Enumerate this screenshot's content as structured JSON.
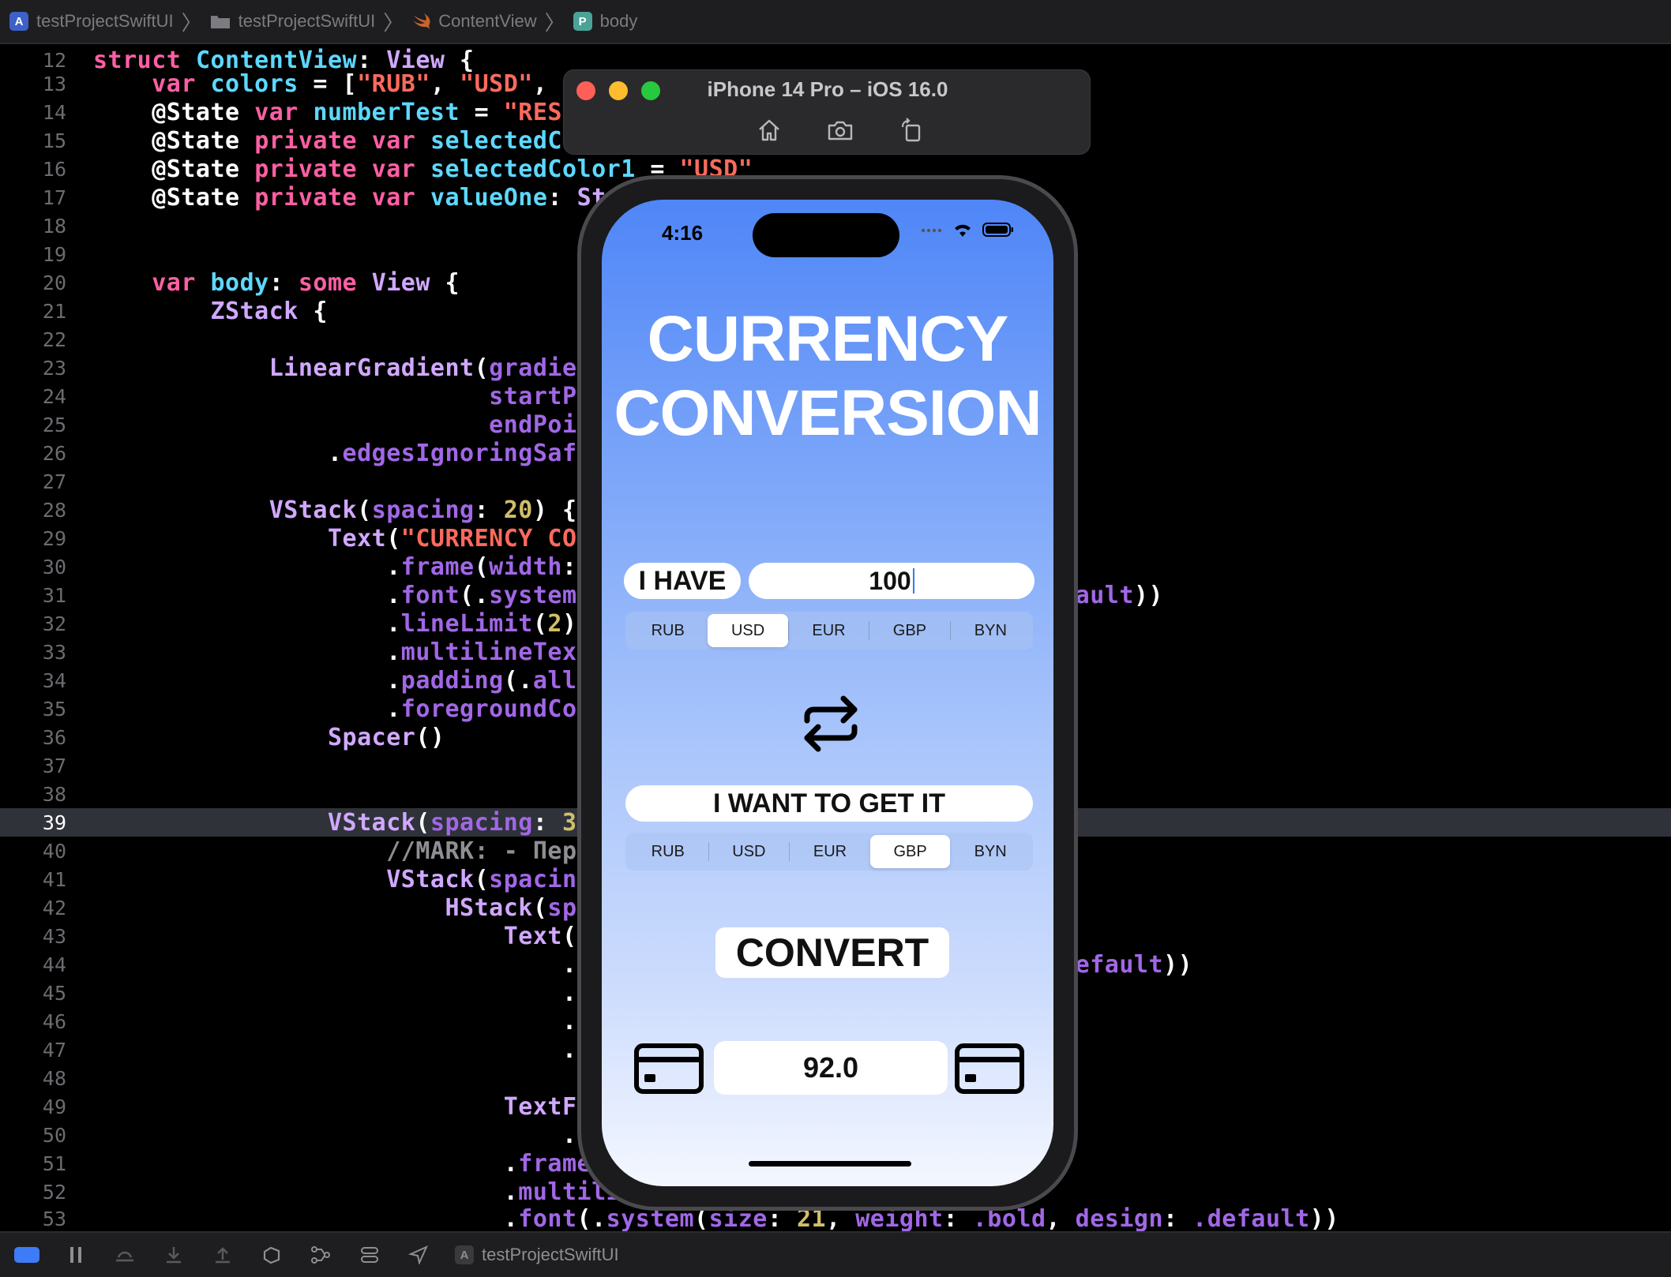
{
  "breadcrumb": {
    "items": [
      "testProjectSwiftUI",
      "testProjectSwiftUI",
      "ContentView",
      "body"
    ],
    "icons": [
      "xcode-project-icon",
      "folder-icon",
      "swift-icon",
      "property-icon"
    ]
  },
  "editor": {
    "current_line": "39",
    "lines": [
      {
        "n": "12"
      },
      {
        "n": "13"
      },
      {
        "n": "14"
      },
      {
        "n": "15"
      },
      {
        "n": "16"
      },
      {
        "n": "17"
      },
      {
        "n": "18"
      },
      {
        "n": "19"
      },
      {
        "n": "20"
      },
      {
        "n": "21"
      },
      {
        "n": "22"
      },
      {
        "n": "23"
      },
      {
        "n": "24"
      },
      {
        "n": "25"
      },
      {
        "n": "26"
      },
      {
        "n": "27"
      },
      {
        "n": "28"
      },
      {
        "n": "29"
      },
      {
        "n": "30"
      },
      {
        "n": "31"
      },
      {
        "n": "32"
      },
      {
        "n": "33"
      },
      {
        "n": "34"
      },
      {
        "n": "35"
      },
      {
        "n": "36"
      },
      {
        "n": "37"
      },
      {
        "n": "38"
      },
      {
        "n": "39"
      },
      {
        "n": "40"
      },
      {
        "n": "41"
      },
      {
        "n": "42"
      },
      {
        "n": "43"
      },
      {
        "n": "44"
      },
      {
        "n": "45"
      },
      {
        "n": "46"
      },
      {
        "n": "47"
      },
      {
        "n": "48"
      },
      {
        "n": "49"
      },
      {
        "n": "50"
      },
      {
        "n": "51"
      },
      {
        "n": "52"
      },
      {
        "n": "53"
      }
    ]
  },
  "simulator": {
    "title": "iPhone 14 Pro – iOS 16.0",
    "tools": [
      "home-icon",
      "screenshot-icon",
      "rotate-icon"
    ]
  },
  "app": {
    "status_time": "4:16",
    "title_line1": "CURRENCY",
    "title_line2": "CONVERSION",
    "have_label": "I HAVE",
    "have_value": "100",
    "currencies": [
      "RUB",
      "USD",
      "EUR",
      "GBP",
      "BYN"
    ],
    "from_selected": "USD",
    "want_label": "I WANT TO GET IT",
    "to_selected": "GBP",
    "convert_label": "CONVERT",
    "result": "92.0"
  },
  "debugbar": {
    "scheme": "testProjectSwiftUI"
  },
  "colors": {
    "keyword": "#fc5fa3",
    "type": "#d0a8ff",
    "string": "#fc6a5d",
    "number": "#d0bf69",
    "property": "#a167e6",
    "identifier": "#5dd8ff",
    "gradient_top": "#4f86f7",
    "gradient_bottom": "#f4f7ff"
  }
}
